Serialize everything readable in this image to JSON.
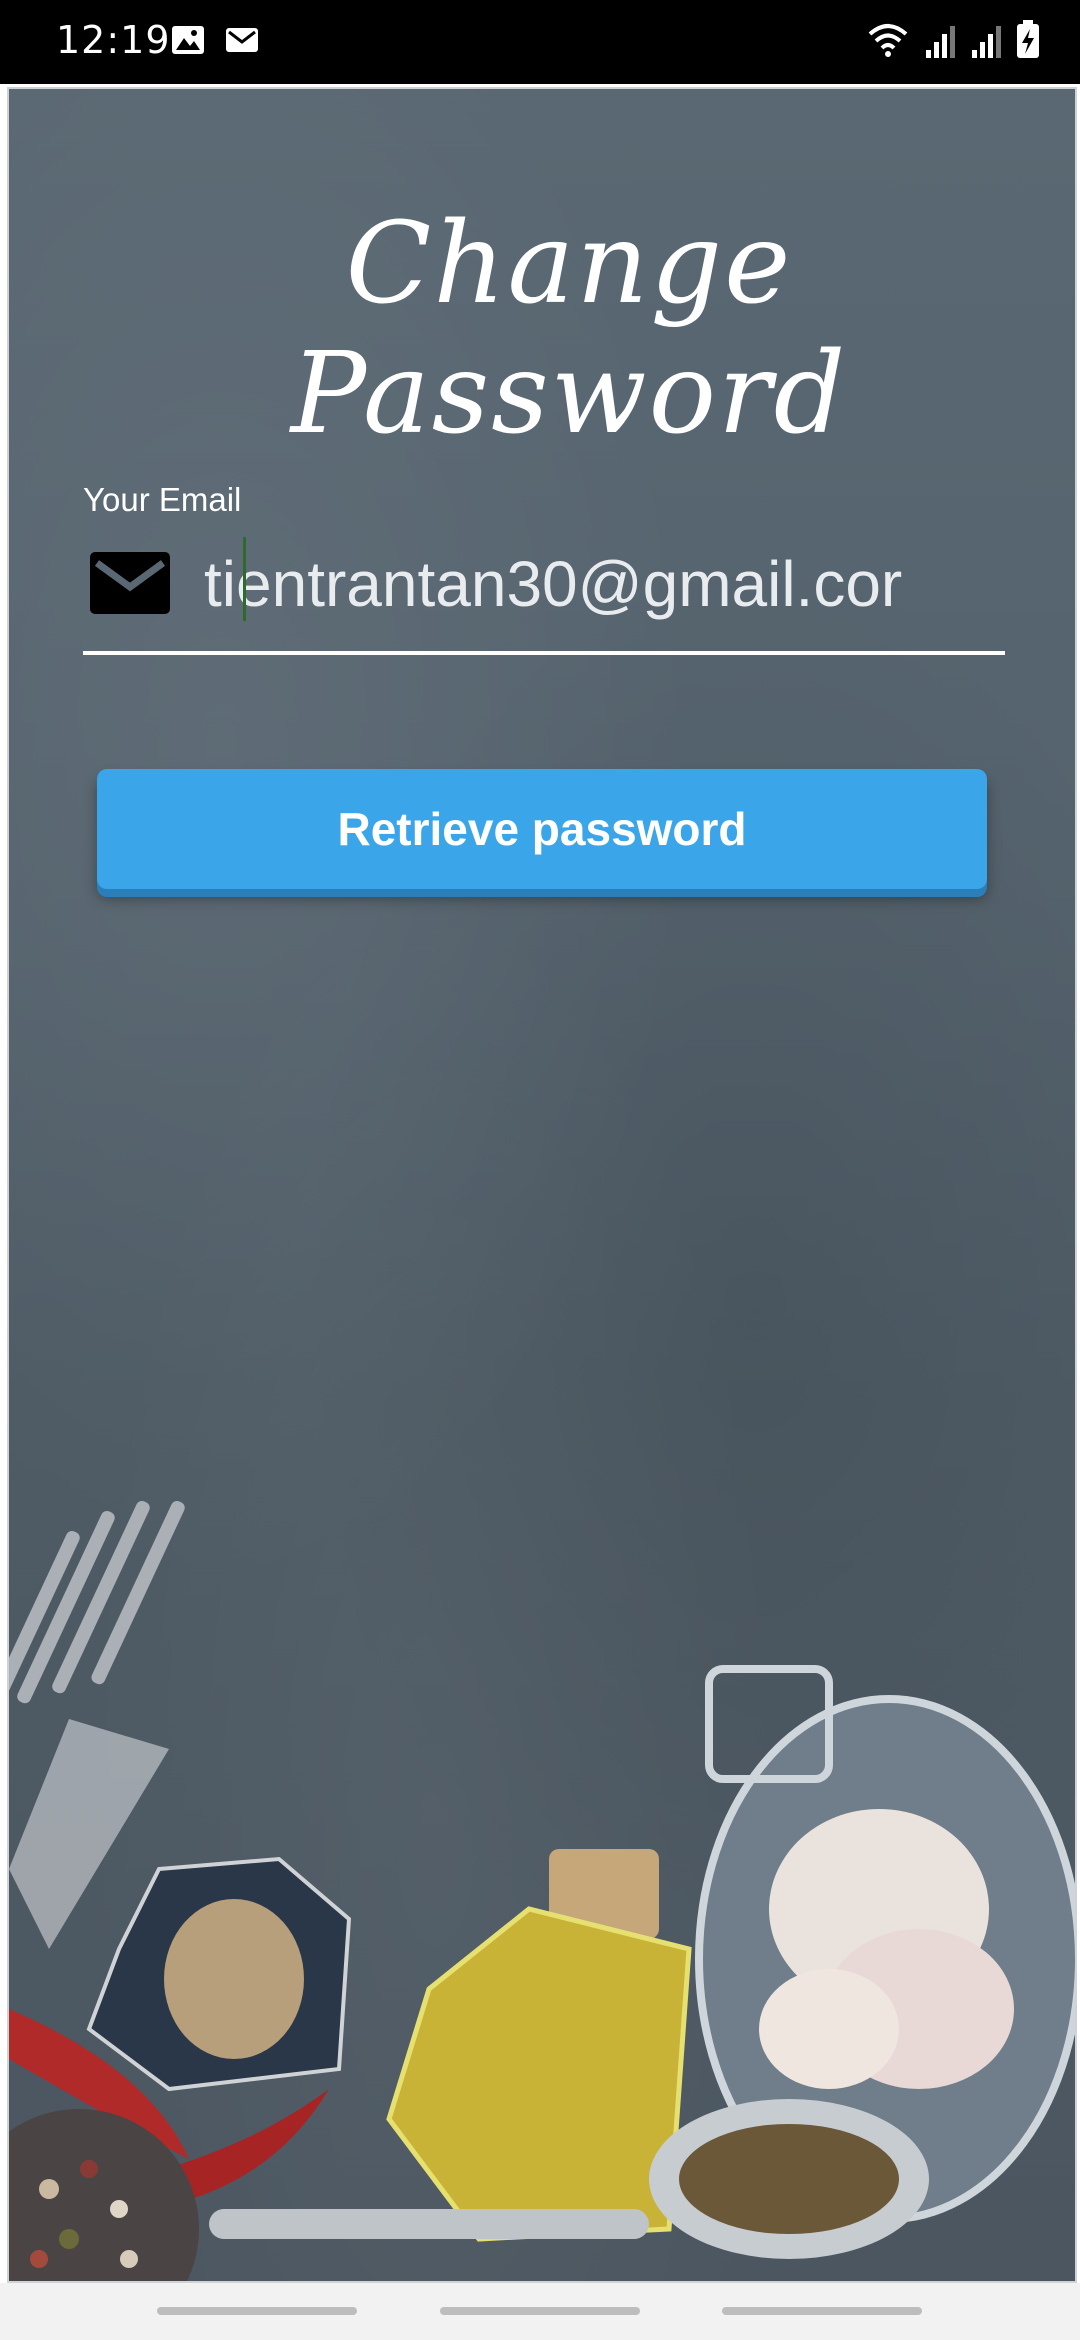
{
  "status_bar": {
    "time": "12:19",
    "left_icons": [
      "image-icon",
      "mail-icon"
    ],
    "right_icons": [
      "wifi-icon",
      "signal-icon",
      "signal-icon",
      "battery-charging-icon"
    ]
  },
  "page": {
    "title": "Change Password"
  },
  "form": {
    "email_label": "Your Email",
    "email_value": "tientrantan30@gmail.cor",
    "email_icon": "mail-icon",
    "submit_label": "Retrieve password"
  },
  "colors": {
    "button": "#3aa5e8",
    "background": "#55636e",
    "text": "#ffffff"
  },
  "background_illustration": "kitchen-ingredients"
}
